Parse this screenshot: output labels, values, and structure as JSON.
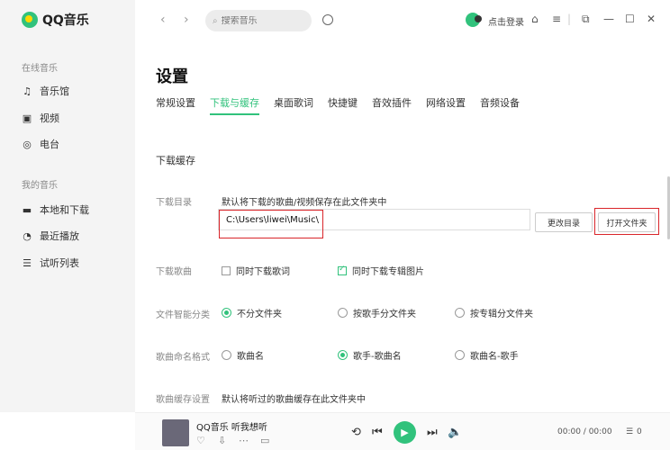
{
  "app": {
    "name": "QQ音乐",
    "accent": "#31c27c",
    "highlight": "#d9252a"
  },
  "sidebar": {
    "section_online": "在线音乐",
    "online_items": [
      {
        "label": "音乐馆",
        "icon": "music-note-icon"
      },
      {
        "label": "视频",
        "icon": "video-icon"
      },
      {
        "label": "电台",
        "icon": "radio-icon"
      }
    ],
    "section_mine": "我的音乐",
    "mine_items": [
      {
        "label": "本地和下载",
        "icon": "monitor-icon"
      },
      {
        "label": "最近播放",
        "icon": "clock-icon"
      },
      {
        "label": "试听列表",
        "icon": "playlist-icon"
      }
    ]
  },
  "topbar": {
    "search_placeholder": "搜索音乐",
    "login_label": "点击登录"
  },
  "settings": {
    "title": "设置",
    "tabs": [
      "常规设置",
      "下载与缓存",
      "桌面歌词",
      "快捷键",
      "音效插件",
      "网络设置",
      "音频设备"
    ],
    "active_tab": "下载与缓存",
    "section_title": "下载缓存",
    "download_dir": {
      "label": "下载目录",
      "desc": "默认将下载的歌曲/视频保存在此文件夹中",
      "path": "C:\\Users\\liwei\\Music\\",
      "change_button": "更改目录",
      "open_button": "打开文件夹"
    },
    "download_song": {
      "label": "下载歌曲",
      "opt_lyrics": "同时下载歌词",
      "opt_lyrics_checked": false,
      "opt_cover": "同时下载专辑图片",
      "opt_cover_checked": true
    },
    "classify": {
      "label": "文件智能分类",
      "options": [
        "不分文件夹",
        "按歌手分文件夹",
        "按专辑分文件夹"
      ],
      "selected": 0
    },
    "naming": {
      "label": "歌曲命名格式",
      "options": [
        "歌曲名",
        "歌手-歌曲名",
        "歌曲名-歌手"
      ],
      "selected": 1
    },
    "cache": {
      "label": "歌曲缓存设置",
      "desc": "默认将听过的歌曲缓存在此文件夹中"
    }
  },
  "player": {
    "song": "QQ音乐 听我想听",
    "time": "00:00 / 00:00",
    "playlist_count": "0"
  }
}
